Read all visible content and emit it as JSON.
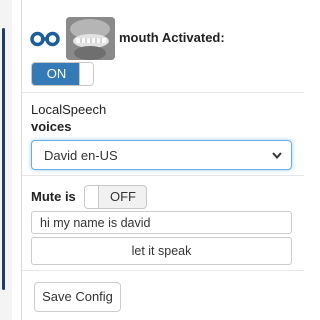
{
  "service": {
    "name": "mouth",
    "status_text": "mouth Activated:",
    "activation_toggle": {
      "label": "ON",
      "state": "on"
    }
  },
  "speech": {
    "engine_label": "LocalSpeech",
    "voices_label": "voices",
    "selected_voice": "David en-US"
  },
  "mute": {
    "label": "Mute is",
    "toggle_label": "OFF",
    "state": "off"
  },
  "speak": {
    "text_value": "hi my name is david",
    "button_label": "let it speak"
  },
  "footer": {
    "save_label": "Save Config"
  },
  "colors": {
    "accent": "#337ab7",
    "focus_border": "#66afe9",
    "icon": "#1c5e9c"
  },
  "icons": [
    "chain-link-icon",
    "chevron-down-icon"
  ]
}
